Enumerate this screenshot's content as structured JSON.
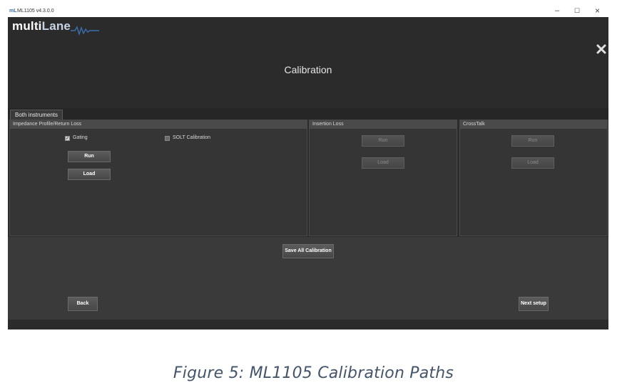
{
  "window": {
    "app_icon": "mL",
    "title": "ML1105 v4.3.0.0",
    "controls": {
      "minimize": "–",
      "maximize": "☐",
      "close": "×"
    }
  },
  "logo": {
    "part1": "multi",
    "part2": "Lane"
  },
  "page": {
    "title": "Calibration"
  },
  "tabs": [
    {
      "label": "Both instruments"
    }
  ],
  "panels": {
    "impedance": {
      "title": "Impedance Profile/Return Loss",
      "gating": {
        "label": "Gating",
        "checked": true
      },
      "solt": {
        "label": "SOLT Calibration",
        "checked": false
      },
      "run_label": "Run",
      "load_label": "Load"
    },
    "insertion": {
      "title": "Insertion Loss",
      "run_label": "Run",
      "load_label": "Load"
    },
    "crosstalk": {
      "title": "CrossTalk",
      "run_label": "Run",
      "load_label": "Load"
    }
  },
  "actions": {
    "save_all_label": "Save All Calibration",
    "back_label": "Back",
    "next_label": "Next setup"
  },
  "caption": "Figure 5: ML1105 Calibration Paths",
  "colors": {
    "window_bg": "#2c2c2c",
    "panel_bg": "#353535",
    "logo_accent": "#3a6fb0"
  }
}
